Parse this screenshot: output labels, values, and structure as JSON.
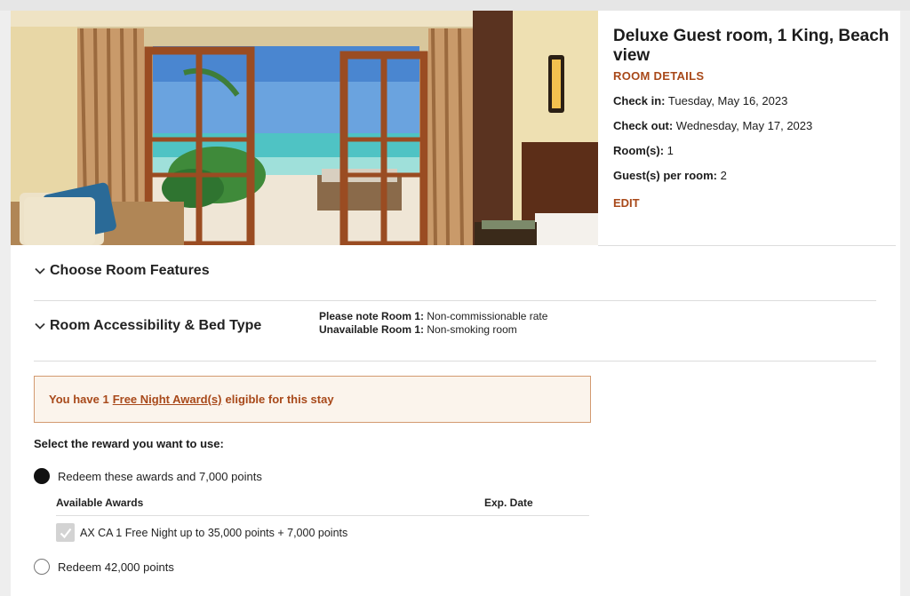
{
  "room": {
    "title": "Deluxe Guest room, 1 King, Beach view",
    "details_label": "ROOM DETAILS",
    "check_in_label": "Check in:",
    "check_in_value": "Tuesday, May 16, 2023",
    "check_out_label": "Check out:",
    "check_out_value": "Wednesday, May 17, 2023",
    "rooms_label": "Room(s):",
    "rooms_value": "1",
    "guests_label": "Guest(s) per room:",
    "guests_value": "2",
    "edit_label": "EDIT"
  },
  "sections": {
    "room_features": "Choose Room Features",
    "accessibility": "Room Accessibility & Bed Type"
  },
  "notes": {
    "note1_label": "Please note Room 1:",
    "note1_value": "Non-commissionable rate",
    "note2_label": "Unavailable Room 1:",
    "note2_value": "Non-smoking room"
  },
  "banner": {
    "prefix": "You have 1",
    "link": "Free Night Award(s)",
    "suffix": "eligible for this stay"
  },
  "rewards": {
    "select_label": "Select the reward you want to use:",
    "option1_label": "Redeem these awards and 7,000 points",
    "option1_selected": true,
    "awards_column": "Available Awards",
    "exp_column": "Exp. Date",
    "award_item": "AX CA 1 Free Night up to 35,000 points + 7,000 points",
    "award_checked": true,
    "option2_label": "Redeem 42,000 points",
    "option2_selected": false
  },
  "colors": {
    "accent": "#a8491a",
    "banner_bg": "#fbf4ec",
    "banner_border": "#d39a70"
  },
  "icons": [
    "chevron-down-icon",
    "checkmark-icon",
    "radio-icon"
  ]
}
